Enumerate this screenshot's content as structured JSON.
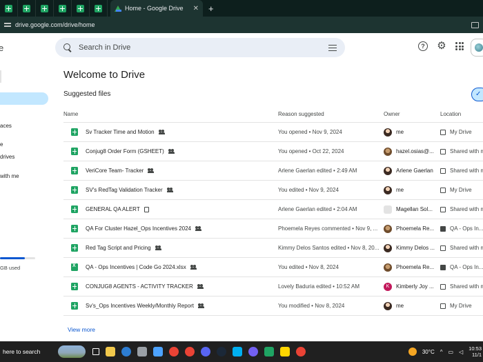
{
  "browser": {
    "active_tab_title": "Home - Google Drive",
    "url": "drive.google.com/drive/home",
    "new_tab_label": "+",
    "close_label": "✕"
  },
  "header": {
    "brand_fragment": "e",
    "search_placeholder": "Search in Drive",
    "help_label": "?"
  },
  "sidebar": {
    "items": [
      {
        "label": "aces"
      },
      {
        "label": "e"
      },
      {
        "label": "drives"
      },
      {
        "label": "with me"
      }
    ],
    "storage_text": "GB used",
    "storage_fraction": 0.7
  },
  "main": {
    "title": "Welcome to Drive",
    "suggested_label": "Suggested files",
    "columns": {
      "name": "Name",
      "reason": "Reason suggested",
      "owner": "Owner",
      "location": "Location"
    },
    "files": [
      {
        "name": "Sv Tracker Time and Motion",
        "type": "sheet",
        "badge": "shared",
        "reason": "You opened • Nov 9, 2024",
        "owner": "me",
        "owner_avatar": "photo",
        "location": "My Drive",
        "loc_icon": "drive"
      },
      {
        "name": "Conjug8 Order Form (GSHEET)",
        "type": "sheet",
        "badge": "shared",
        "reason": "You opened • Oct 22, 2024",
        "owner": "hazel.osias@...",
        "owner_avatar": "alt",
        "location": "Shared with me",
        "loc_icon": "shared"
      },
      {
        "name": "VeriCore Team- Tracker",
        "type": "sheet",
        "badge": "shared",
        "reason": "Arlene Gaerlan edited • 2:49 AM",
        "owner": "Arlene Gaerlan",
        "owner_avatar": "photo",
        "location": "Shared with me",
        "loc_icon": "shared"
      },
      {
        "name": "SV's RedTag Validation Tracker",
        "type": "sheet",
        "badge": "shared",
        "reason": "You edited • Nov 9, 2024",
        "owner": "me",
        "owner_avatar": "photo",
        "location": "My Drive",
        "loc_icon": "drive"
      },
      {
        "name": "GENERAL QA ALERT",
        "type": "sheet",
        "badge": "org",
        "reason": "Arlene Gaerlan edited • 2:04 AM",
        "owner": "Magellan Sol...",
        "owner_avatar": "org",
        "location": "Shared with me",
        "loc_icon": "shared"
      },
      {
        "name": "QA For Cluster Hazel_Ops Incentives 2024",
        "type": "sheet",
        "badge": "shared",
        "reason": "Phoemela Reyes commented • Nov 9, ...",
        "owner": "Phoemela Re...",
        "owner_avatar": "alt",
        "location": "QA - Ops In...",
        "loc_icon": "folder"
      },
      {
        "name": "Red Tag Script and Pricing",
        "type": "sheet",
        "badge": "shared",
        "reason": "Kimmy Delos Santos edited • Nov 8, 20...",
        "owner": "Kimmy Delos ...",
        "owner_avatar": "photo",
        "location": "Shared with me",
        "loc_icon": "shared"
      },
      {
        "name": "QA - Ops Incentives | Code Go 2024.xlsx",
        "type": "xlsx",
        "badge": "shared",
        "reason": "You edited • Nov 8, 2024",
        "owner": "Phoemela Re...",
        "owner_avatar": "alt",
        "location": "QA - Ops In...",
        "loc_icon": "folder"
      },
      {
        "name": "CONJUG8 AGENTS - ACTIVITY TRACKER",
        "type": "sheet",
        "badge": "shared",
        "reason": "Lovely Baduria edited • 10:52 AM",
        "owner": "Kimberly Joy ...",
        "owner_avatar": "k",
        "owner_initial": "K",
        "location": "Shared with me",
        "loc_icon": "shared"
      },
      {
        "name": "Sv's_Ops Incentives Weekly/Monthly Report",
        "type": "sheet",
        "badge": "shared",
        "reason": "You modified • Nov 8, 2024",
        "owner": "me",
        "owner_avatar": "photo",
        "location": "My Drive",
        "loc_icon": "drive"
      }
    ],
    "view_more": "View more"
  },
  "taskbar": {
    "search_text": "here to search",
    "temperature": "30°C",
    "time": "10:53",
    "date": "11/1"
  },
  "colors": {
    "accent": "#0b57d0",
    "selected_bg": "#c2e7ff",
    "sheets_green": "#1fa463",
    "search_bg": "#e9eef6",
    "chrome_dark": "#0d1f1d"
  }
}
